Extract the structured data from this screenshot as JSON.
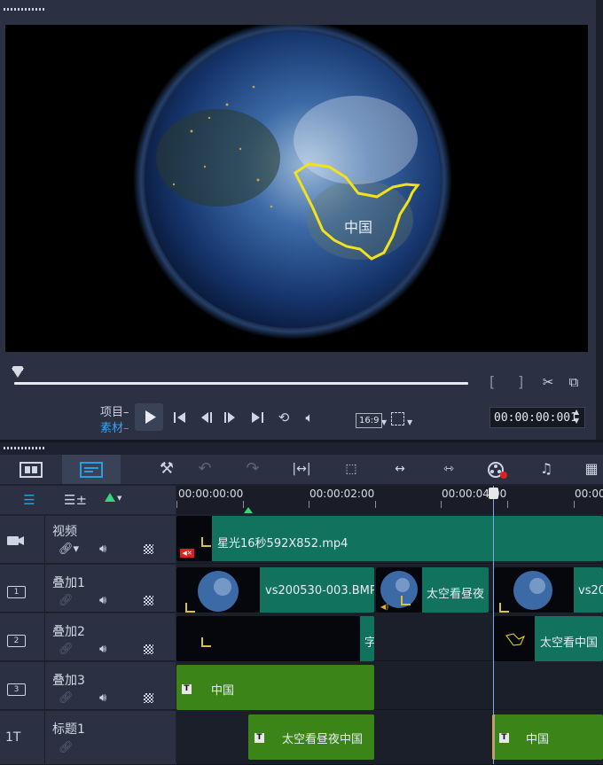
{
  "preview": {
    "overlay_text": "中国",
    "mode_project": "项目",
    "mode_clip": "素材",
    "aspect_ratio": "16:9",
    "timecode": "00:00:00:001",
    "bracket_in": "[",
    "bracket_out": "]"
  },
  "timeline": {
    "ruler": [
      "00:00:00:00",
      "00:00:02:00",
      "00:00:04:00",
      "00:00"
    ],
    "tracks": [
      {
        "name": "视频",
        "id_badge": ""
      },
      {
        "name": "叠加1",
        "id_badge": "1"
      },
      {
        "name": "叠加2",
        "id_badge": "2"
      },
      {
        "name": "叠加3",
        "id_badge": "3"
      },
      {
        "name": "标题1",
        "id_badge": "1T"
      }
    ],
    "clips": {
      "video": "星光16秒592X852.mp4",
      "overlay1_a": "vs200530-003.BMP",
      "overlay1_b": "太空看昼夜",
      "overlay1_c": "vs20",
      "overlay2_a": "字",
      "overlay2_b": "太空看中国",
      "overlay3_a": "中国",
      "title1_a": "太空看昼夜中国",
      "title1_b": "中国"
    }
  },
  "colors": {
    "media_clip": "#11725e",
    "title_clip": "#3b8518",
    "outline": "#f2e21a",
    "accent": "#2a9fe0"
  }
}
